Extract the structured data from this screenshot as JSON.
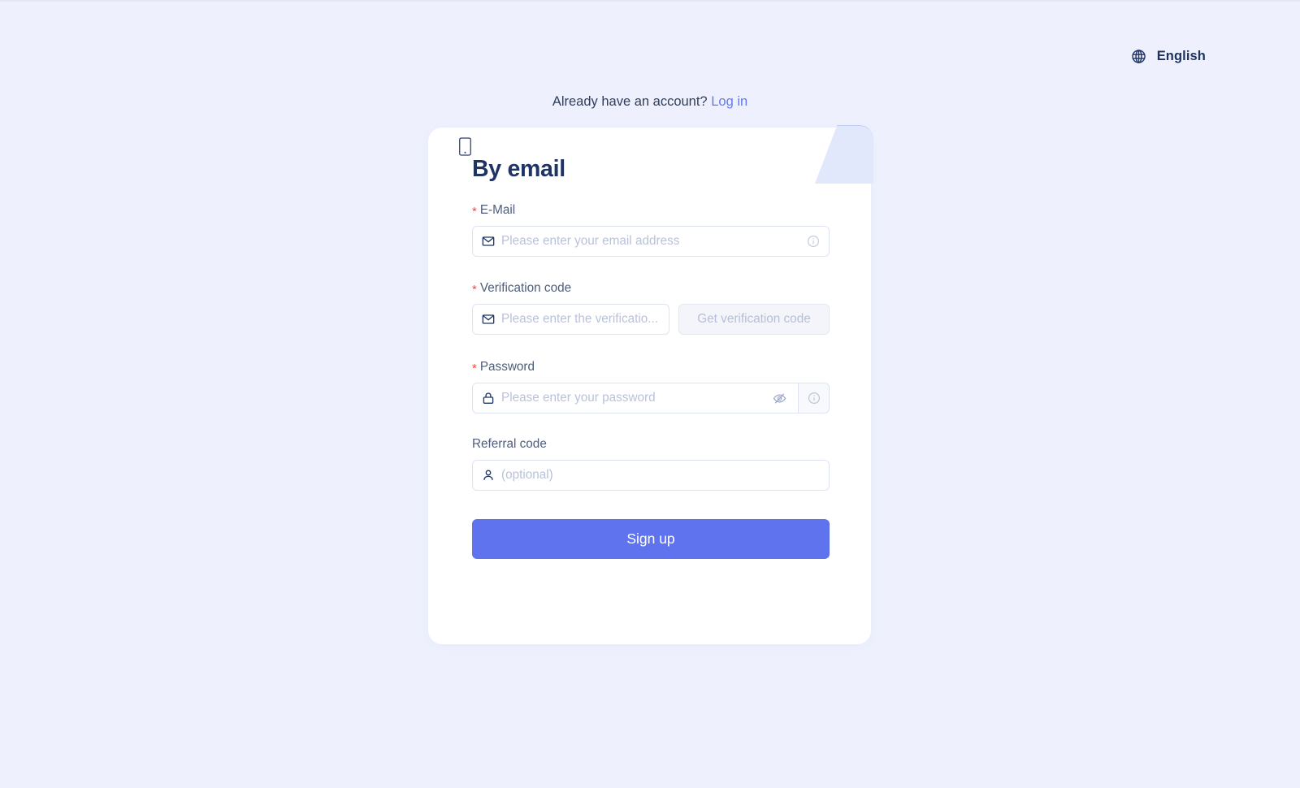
{
  "page": {
    "background_color": "#eef1fd"
  },
  "language_selector": {
    "icon": "globe-icon",
    "label": "English"
  },
  "account_prompt": {
    "text": "Already have an account?",
    "link_label": "Log in",
    "link_color": "#6179f5"
  },
  "card": {
    "title": "By email",
    "corner_tab": {
      "icon": "mobile-phone-icon",
      "background_color": "#e2e8fb"
    },
    "form": {
      "email": {
        "required_marker": "*",
        "label": "E-Mail",
        "prefix_icon": "envelope-icon",
        "placeholder": "Please enter your email address",
        "value": "",
        "suffix_icon": "info-circle-icon"
      },
      "verification_code": {
        "required_marker": "*",
        "label": "Verification code",
        "prefix_icon": "envelope-icon",
        "placeholder": "Please enter the verificatio...",
        "value": "",
        "button_label": "Get verification code",
        "button_disabled": true
      },
      "password": {
        "required_marker": "*",
        "label": "Password",
        "prefix_icon": "lock-icon",
        "placeholder": "Please enter your password",
        "value": "",
        "toggle_icon": "eye-slash-icon",
        "suffix_icon": "info-circle-icon"
      },
      "referral_code": {
        "required_marker": "",
        "label": "Referral code",
        "prefix_icon": "user-icon",
        "placeholder": "(optional)",
        "value": ""
      },
      "submit": {
        "label": "Sign up",
        "color": "#6073ef"
      }
    }
  }
}
